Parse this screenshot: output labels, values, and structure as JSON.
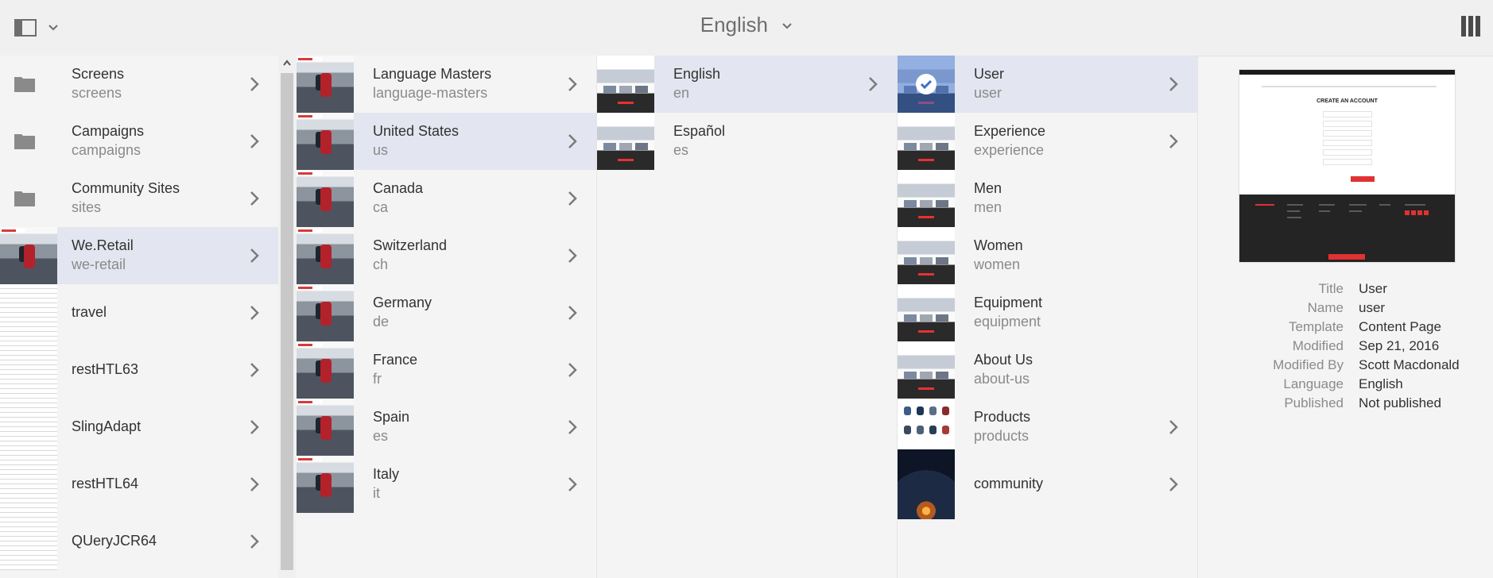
{
  "header": {
    "title": "English"
  },
  "columns": [
    {
      "items": [
        {
          "label": "Screens",
          "sub": "screens",
          "icon": "folder-icon"
        },
        {
          "label": "Campaigns",
          "sub": "campaigns",
          "icon": "folder-icon"
        },
        {
          "label": "Community Sites",
          "sub": "sites",
          "icon": "folder-icon"
        },
        {
          "label": "We.Retail",
          "sub": "we-retail",
          "selected": true
        },
        {
          "label": "travel",
          "sub": ""
        },
        {
          "label": "restHTL63",
          "sub": ""
        },
        {
          "label": "SlingAdapt",
          "sub": ""
        },
        {
          "label": "restHTL64",
          "sub": ""
        },
        {
          "label": "QUeryJCR64",
          "sub": ""
        }
      ]
    },
    {
      "items": [
        {
          "label": "Language Masters",
          "sub": "language-masters"
        },
        {
          "label": "United States",
          "sub": "us",
          "selected": true
        },
        {
          "label": "Canada",
          "sub": "ca"
        },
        {
          "label": "Switzerland",
          "sub": "ch"
        },
        {
          "label": "Germany",
          "sub": "de"
        },
        {
          "label": "France",
          "sub": "fr"
        },
        {
          "label": "Spain",
          "sub": "es"
        },
        {
          "label": "Italy",
          "sub": "it"
        }
      ]
    },
    {
      "items": [
        {
          "label": "English",
          "sub": "en",
          "selected": true
        },
        {
          "label": "Español",
          "sub": "es"
        }
      ]
    },
    {
      "items": [
        {
          "label": "User",
          "sub": "user",
          "selected": true
        },
        {
          "label": "Experience",
          "sub": "experience"
        },
        {
          "label": "Men",
          "sub": "men"
        },
        {
          "label": "Women",
          "sub": "women"
        },
        {
          "label": "Equipment",
          "sub": "equipment"
        },
        {
          "label": "About Us",
          "sub": "about-us"
        },
        {
          "label": "Products",
          "sub": "products"
        },
        {
          "label": "community",
          "sub": ""
        }
      ]
    }
  ],
  "preview": {
    "heading": "CREATE AN ACCOUNT"
  },
  "meta": [
    {
      "key": "Title",
      "value": "User"
    },
    {
      "key": "Name",
      "value": "user"
    },
    {
      "key": "Template",
      "value": "Content Page"
    },
    {
      "key": "Modified",
      "value": "Sep 21, 2016"
    },
    {
      "key": "Modified By",
      "value": "Scott Macdonald"
    },
    {
      "key": "Language",
      "value": "English"
    },
    {
      "key": "Published",
      "value": "Not published"
    }
  ],
  "colors": {
    "selected_row": "#e3e6f0",
    "accent_red": "#e03232"
  }
}
